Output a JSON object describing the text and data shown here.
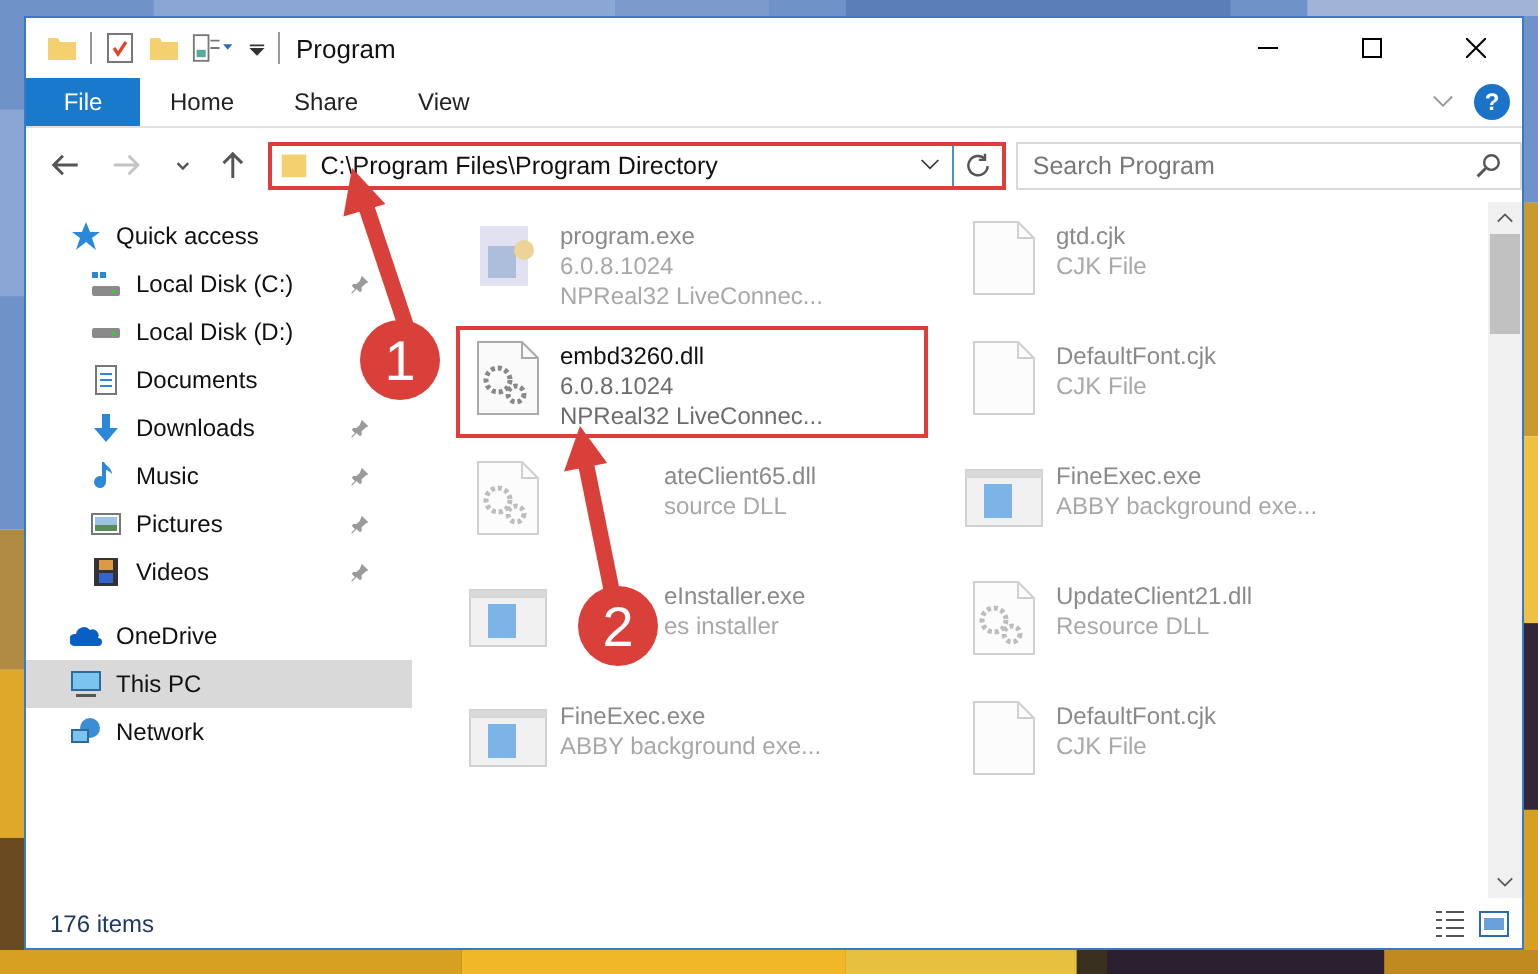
{
  "window": {
    "title": "Program"
  },
  "ribbon_tabs": [
    {
      "label": "File",
      "kind": "file"
    },
    {
      "label": "Home",
      "kind": "tab"
    },
    {
      "label": "Share",
      "kind": "tab"
    },
    {
      "label": "View",
      "kind": "tab"
    }
  ],
  "help_button": "?",
  "nav_buttons": [
    {
      "kind": "back",
      "disabled": false
    },
    {
      "kind": "forward",
      "disabled": true
    },
    {
      "kind": "recent",
      "disabled": false
    },
    {
      "kind": "up",
      "disabled": false
    }
  ],
  "address": {
    "value": "C:\\Program Files\\Program Directory",
    "highlighted": true
  },
  "search": {
    "placeholder": "Search Program"
  },
  "sidebar": {
    "items": [
      {
        "label": "Quick access",
        "kind": "star",
        "selected": false,
        "children": [
          {
            "label": "Local Disk (C:)",
            "kind": "system-drive",
            "pinned": true,
            "selected": false
          },
          {
            "label": "Local Disk (D:)",
            "kind": "drive",
            "pinned": false,
            "selected": false
          },
          {
            "label": "Documents",
            "kind": "documents",
            "pinned": false,
            "selected": false
          },
          {
            "label": "Downloads",
            "kind": "download",
            "pinned": true,
            "selected": false
          },
          {
            "label": "Music",
            "kind": "music",
            "pinned": true,
            "selected": false
          },
          {
            "label": "Pictures",
            "kind": "pictures",
            "pinned": true,
            "selected": false
          },
          {
            "label": "Videos",
            "kind": "videos",
            "pinned": true,
            "selected": false
          }
        ]
      },
      {
        "label": "OneDrive",
        "kind": "cloud",
        "selected": false
      },
      {
        "label": "This PC",
        "kind": "pc",
        "selected": true
      },
      {
        "label": "Network",
        "kind": "network",
        "selected": false
      }
    ]
  },
  "files": [
    {
      "name": "program.exe",
      "details": [
        "6.0.8.1024",
        "NPReal32 LiveConnec..."
      ],
      "kind": "program",
      "blurred": true,
      "highlighted": false,
      "covered": false
    },
    {
      "name": "gtd.cjk",
      "details": [
        "CJK File"
      ],
      "kind": "blank",
      "blurred": true,
      "highlighted": false,
      "covered": false
    },
    {
      "name": "embd3260.dll",
      "details": [
        "6.0.8.1024",
        "NPReal32 LiveConnec..."
      ],
      "kind": "gears",
      "blurred": false,
      "highlighted": true,
      "covered": false
    },
    {
      "name": "DefaultFont.cjk",
      "details": [
        "CJK File"
      ],
      "kind": "blank",
      "blurred": true,
      "highlighted": false,
      "covered": false
    },
    {
      "name": "ateClient65.dll",
      "details": [
        "source DLL"
      ],
      "kind": "gears",
      "blurred": true,
      "highlighted": false,
      "covered": true
    },
    {
      "name": "FineExec.exe",
      "details": [
        "ABBY background exe..."
      ],
      "kind": "app",
      "blurred": true,
      "highlighted": false,
      "covered": false
    },
    {
      "name": "eInstaller.exe",
      "details": [
        "es installer"
      ],
      "kind": "app",
      "blurred": true,
      "highlighted": false,
      "covered": true
    },
    {
      "name": "UpdateClient21.dll",
      "details": [
        "Resource DLL"
      ],
      "kind": "gears",
      "blurred": true,
      "highlighted": false,
      "covered": false
    },
    {
      "name": "FineExec.exe",
      "details": [
        "ABBY background exe..."
      ],
      "kind": "app",
      "blurred": true,
      "highlighted": false,
      "covered": false
    },
    {
      "name": "DefaultFont.cjk",
      "details": [
        "CJK File"
      ],
      "kind": "blank",
      "blurred": true,
      "highlighted": false,
      "covered": false
    }
  ],
  "status_bar": {
    "count": "176 items"
  },
  "callouts": [
    {
      "number": "1"
    },
    {
      "number": "2"
    }
  ]
}
